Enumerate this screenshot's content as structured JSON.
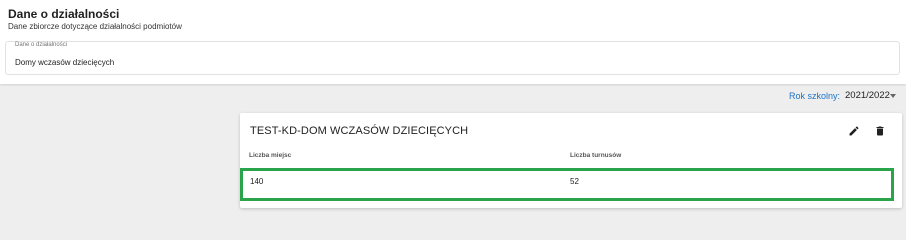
{
  "header": {
    "title": "Dane o działalności",
    "subtitle": "Dane zbiorcze dotyczące działalności podmiotów"
  },
  "category_select": {
    "label": "Dane o działalności",
    "value": "Domy wczasów dziecięcych"
  },
  "school_year": {
    "label": "Rok szkolny:",
    "value": "2021/2022"
  },
  "card": {
    "title": "TEST-KD-DOM WCZASÓW DZIECIĘCYCH",
    "columns": [
      "Liczba miejsc",
      "Liczba turnusów"
    ],
    "row": [
      "140",
      "52"
    ],
    "icons": {
      "edit": "pencil-icon",
      "delete": "trash-icon"
    }
  },
  "colors": {
    "accent": "#1e73c8",
    "highlight": "#2aa44a"
  }
}
